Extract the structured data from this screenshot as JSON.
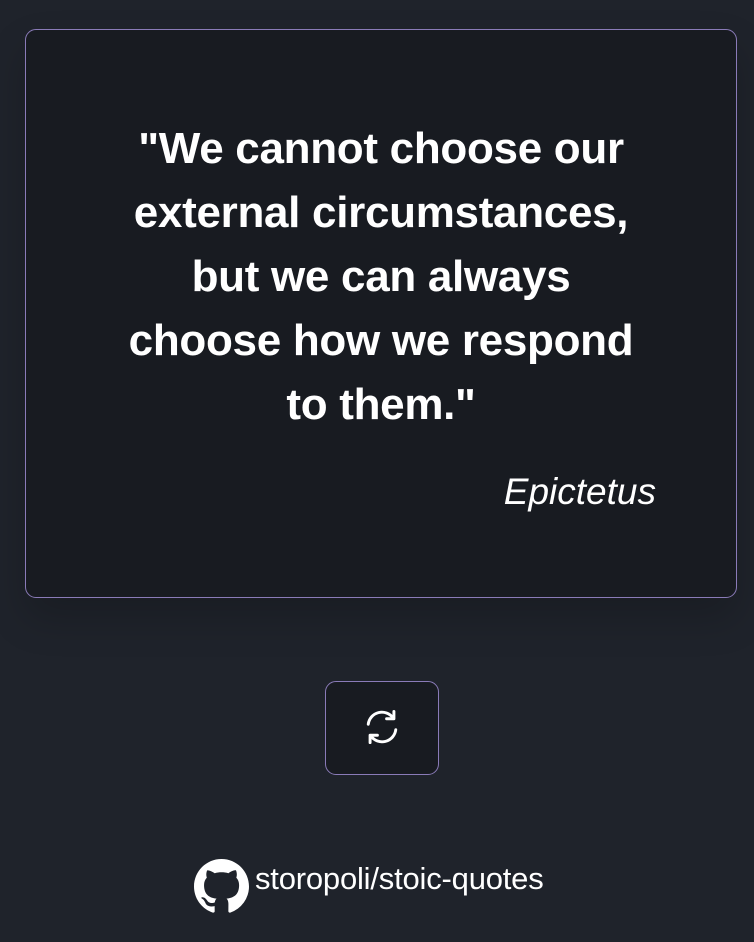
{
  "quote": {
    "text": "\"We cannot choose our external circumstances, but we can always choose how we respond to them.\"",
    "author": "Epictetus"
  },
  "controls": {
    "refresh_icon": "refresh-icon"
  },
  "footer": {
    "icon": "github-icon",
    "repo_label": "storopoli/stoic-quotes"
  },
  "colors": {
    "background": "#1f232b",
    "card": "#181b21",
    "border_accent": "#8a7bb8",
    "text": "#ffffff"
  }
}
